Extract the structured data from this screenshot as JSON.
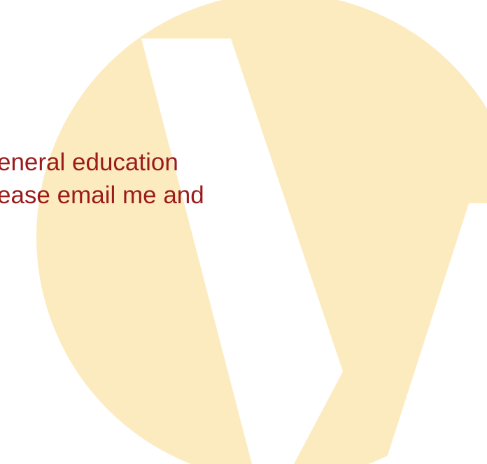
{
  "colors": {
    "background": "#ffffff",
    "watermark": "#fdebc0",
    "text": "#9b1b1b"
  },
  "watermark": {
    "icon": "v-logo-icon"
  },
  "text": {
    "line1": "eneral education",
    "line2": "ease email me and"
  }
}
